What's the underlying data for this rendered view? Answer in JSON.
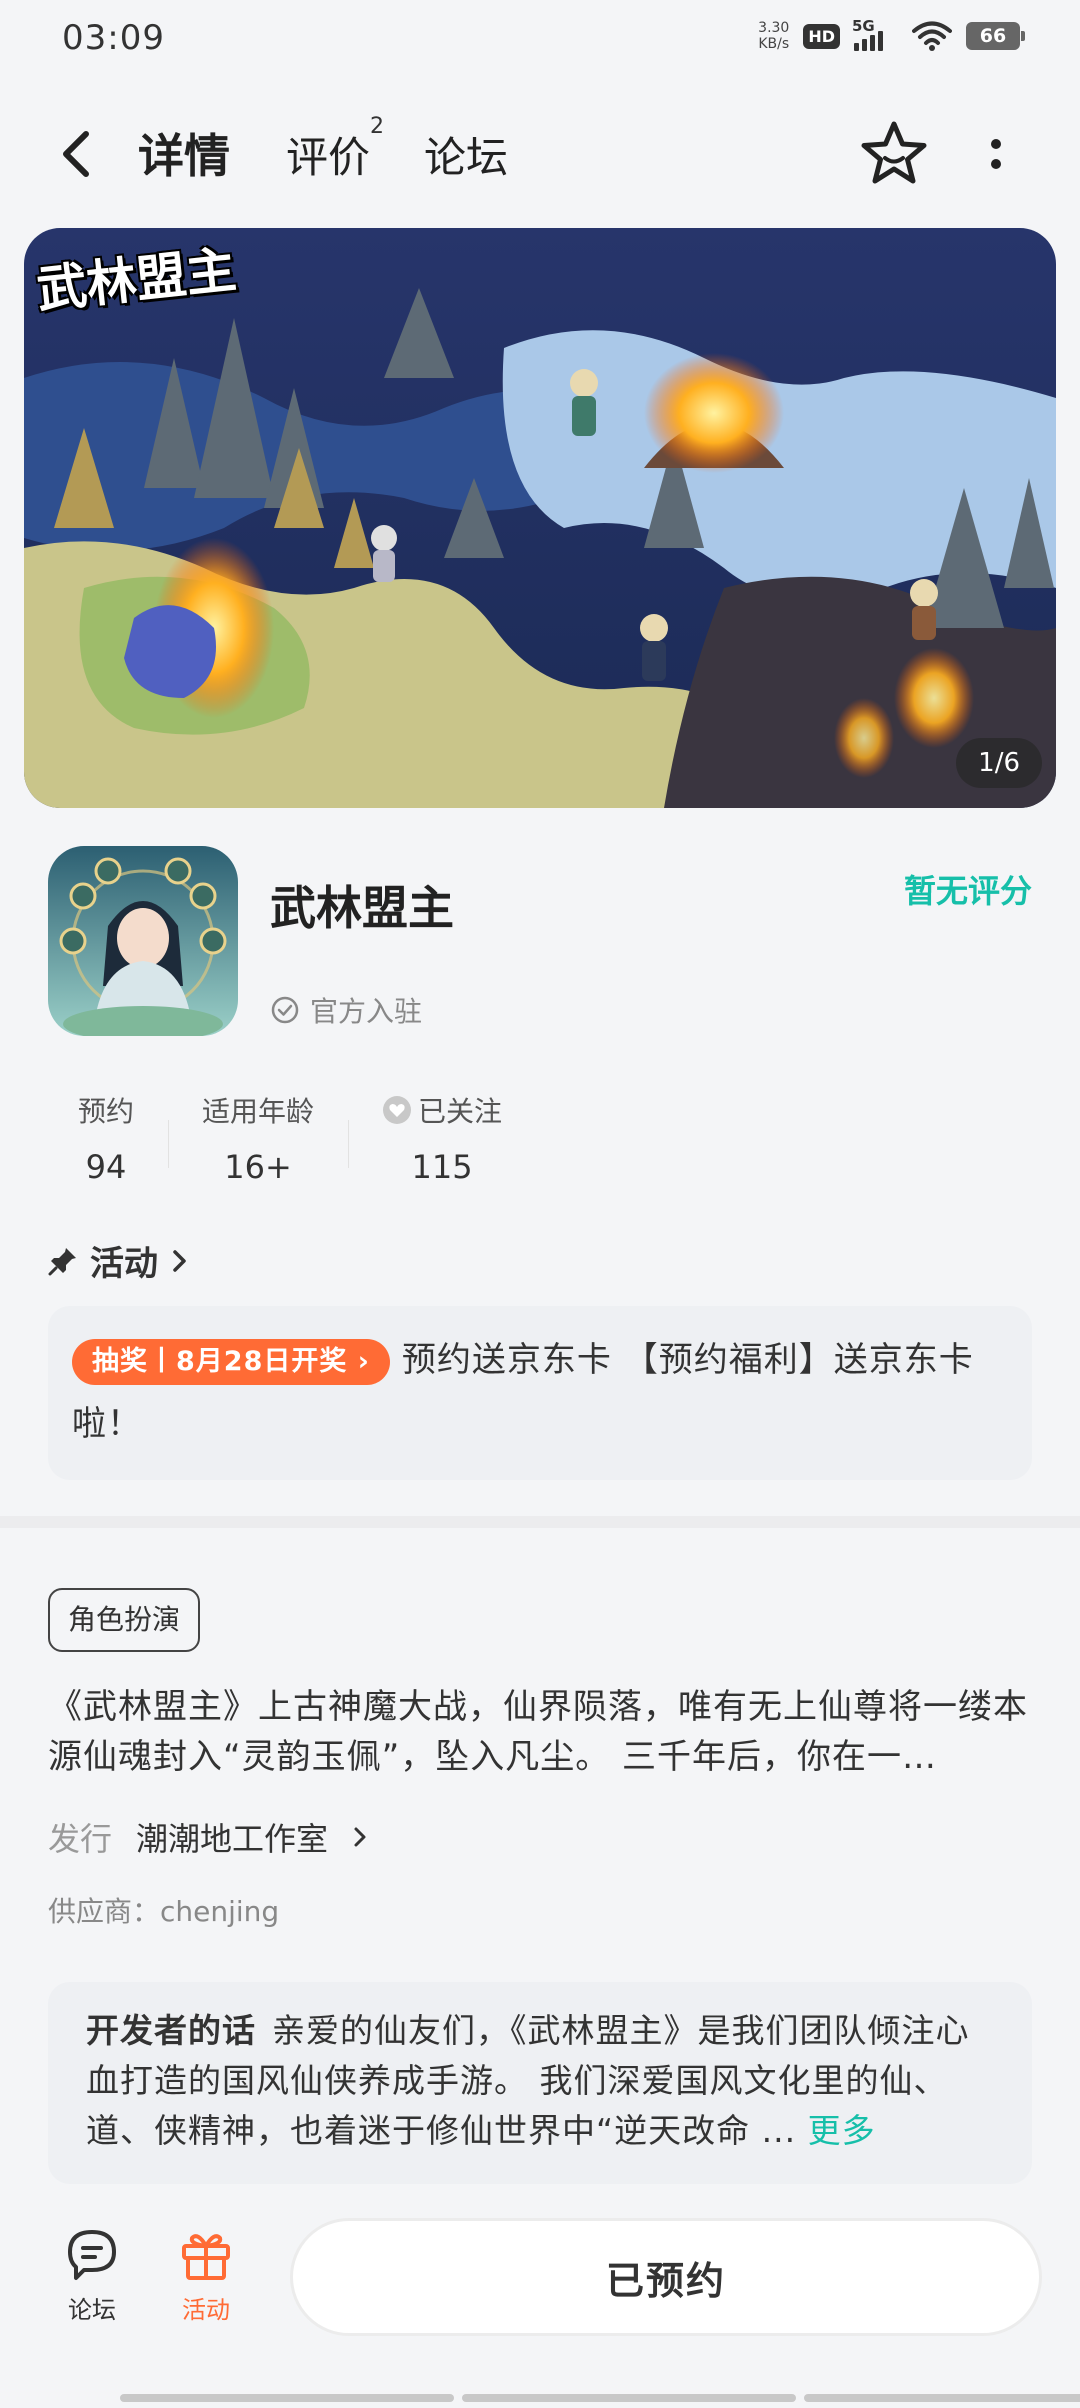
{
  "status_bar": {
    "time": "03:09",
    "net_speed_value": "3.30",
    "net_speed_unit": "KB/s",
    "hd": "HD",
    "network": "5G",
    "battery": "66"
  },
  "header": {
    "tabs": [
      {
        "label": "详情",
        "active": true
      },
      {
        "label": "评价",
        "badge": "2"
      },
      {
        "label": "论坛"
      }
    ]
  },
  "banner": {
    "title": "武林盟主",
    "counter": "1/6"
  },
  "app": {
    "name": "武林盟主",
    "official": "官方入驻",
    "rating": "暂无评分"
  },
  "stats": [
    {
      "label": "预约",
      "value": "94"
    },
    {
      "label": "适用年龄",
      "value": "16+"
    },
    {
      "label": "已关注",
      "value": "115"
    }
  ],
  "activity": {
    "heading": "活动",
    "tag": "抽奖丨8月28日开奖",
    "text": "预约送京东卡 【预约福利】送京东卡啦！"
  },
  "details": {
    "genre": "角色扮演",
    "description": "《武林盟主》上古神魔大战，仙界陨落，唯有无上仙尊将一缕本源仙魂封入“灵韵玉佩”，坠入凡尘。 三千年后，你在一…",
    "publisher_label": "发行",
    "publisher": "潮潮地工作室",
    "supplier": "供应商：chenjing"
  },
  "developer": {
    "label": "开发者的话",
    "text": "亲爱的仙友们，《武林盟主》是我们团队倾注心血打造的国风仙侠养成手游。 我们深爱国风文化里的仙、道、侠精神，也着迷于修仙世界中“逆天改命 ...",
    "more": "更多"
  },
  "bottom_bar": {
    "forum": "论坛",
    "activity": "活动",
    "reserve_button": "已预约"
  },
  "colors": {
    "accent": "#16bfa9",
    "tab_underline": "#25d4c0",
    "orange": "#ff6b35"
  }
}
